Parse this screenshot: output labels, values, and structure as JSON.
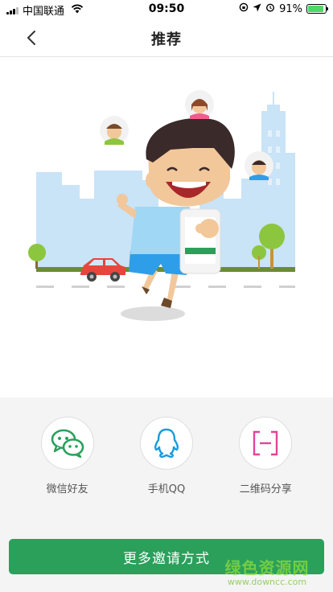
{
  "status_bar": {
    "carrier": "中国联通",
    "time": "09:50",
    "battery": "91%",
    "battery_level": 0.91
  },
  "nav": {
    "title": "推荐",
    "back_icon": "chevron-left-icon"
  },
  "share_options": [
    {
      "label": "微信好友",
      "icon": "wechat-icon",
      "color": "#2aa05b"
    },
    {
      "label": "手机QQ",
      "icon": "qq-penguin-icon",
      "color": "#1a9cdb"
    },
    {
      "label": "二维码分享",
      "icon": "qrcode-icon",
      "color": "#e0459a"
    }
  ],
  "more_button": {
    "label": "更多邀请方式",
    "color": "#2aa05b"
  },
  "watermark": {
    "main": "绿色资源网",
    "url": "www.downcc.com"
  }
}
